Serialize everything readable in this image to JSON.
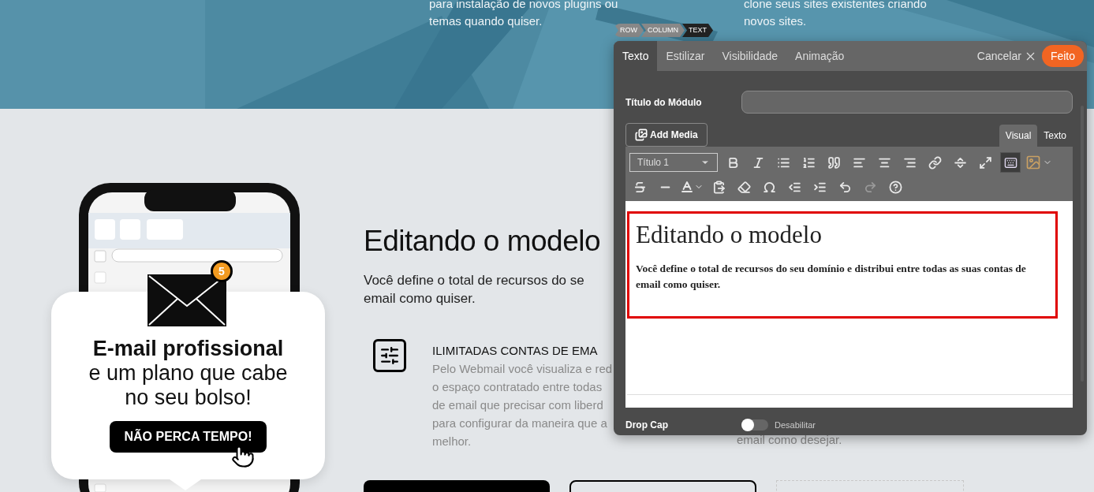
{
  "hero": {
    "columns": [
      {
        "lines": [
          "para instalação de novos plugins ou",
          "temas quando quiser."
        ]
      },
      {
        "lines": [
          "clone seus sites existentes criando",
          "novos sites."
        ]
      }
    ]
  },
  "promo": {
    "badge": "5",
    "heading": "E-mail profissional",
    "lines": [
      "e um plano que cabe",
      "no seu bolso!"
    ],
    "button": "NÃO PERCA TEMPO!"
  },
  "section": {
    "title": "Editando o modelo",
    "lead": [
      "Você define o total de recursos do se",
      "email como quiser."
    ],
    "feature": {
      "title": "ILIMITADAS CONTAS DE EMA",
      "lines": [
        "Pelo Webmail você visualiza e red",
        "o espaço contratado entre todas",
        "de email que precisar com liberd",
        "para configurar da maneira que a",
        "melhor."
      ]
    },
    "side_text": "email como desejar."
  },
  "editor": {
    "breadcrumb": [
      {
        "label": "ROW",
        "selected": false
      },
      {
        "label": "COLUMN",
        "selected": false
      },
      {
        "label": "TEXT",
        "selected": true
      }
    ],
    "tabs": [
      {
        "label": "Texto",
        "selected": true
      },
      {
        "label": "Estilizar",
        "selected": false
      },
      {
        "label": "Visibilidade",
        "selected": false
      },
      {
        "label": "Animação",
        "selected": false
      }
    ],
    "cancel": "Cancelar",
    "done": "Feito",
    "module_title_label": "Título do Módulo",
    "add_media": "Add Media",
    "mode_tabs": [
      {
        "label": "Visual",
        "selected": true
      },
      {
        "label": "Texto",
        "selected": false
      }
    ],
    "format_select": "Título 1",
    "content": {
      "heading": "Editando o modelo",
      "paragraph": "Você define o total de recursos do seu domínio e distribui entre todas as suas contas de email como quiser."
    },
    "drop_cap": {
      "label": "Drop Cap",
      "state_label": "Desabilitar",
      "on": false
    }
  }
}
